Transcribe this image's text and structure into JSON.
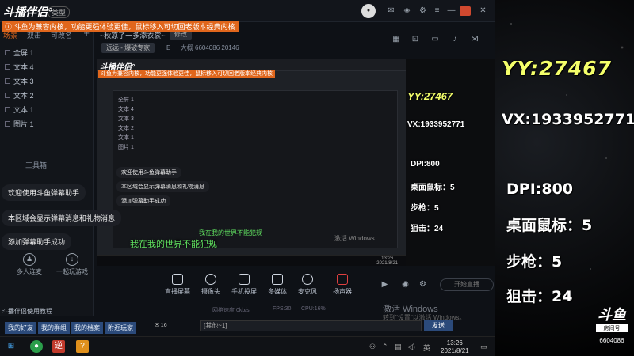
{
  "app": {
    "logo": "斗播伴侣°",
    "badge": "类型",
    "notice": "ⓘ 斗鱼为兼容内核，功能更强体验更佳，鼠标移入可切回老版本经典内核"
  },
  "left": {
    "tabs": [
      "场景",
      "双击",
      "可改名"
    ],
    "sources": [
      "全屏 1",
      "文本 4",
      "文本 3",
      "文本 2",
      "文本 1",
      "图片 1"
    ],
    "toolbar_label": "工具箱",
    "bubbles": [
      "欢迎使用斗鱼弹幕助手",
      "本区域会显示弹幕消息和礼物消息",
      "添加弹幕助手成功"
    ],
    "buttons": [
      "多人连麦",
      "一起玩游戏"
    ],
    "tutorial": "斗播伴侣使用教程"
  },
  "header": {
    "room_title": "~秋凉了一多添衣裳~",
    "edit_label": "修改",
    "category": "远远 - 爆破专家",
    "room_info": "E十. 大概  6604086    20146"
  },
  "preview": {
    "inner_logo": "斗播伴侣°",
    "inner_notice": "斗鱼为兼容内核，功能更强体验更佳，鼠标移入可切回老版本经典内核",
    "inner_overlay": {
      "yy": "YY:27467",
      "vx": "VX:1933952771",
      "dpi": "DPI:800",
      "desk": "桌面鼠标：5",
      "step": "步枪：5",
      "snipe": "狙击：24"
    },
    "nested_rows": [
      "全屏 1",
      "文本 4",
      "文本 3",
      "文本 2",
      "文本 1",
      "图片 1"
    ],
    "nested_bubbles": [
      "欢迎使用斗鱼弹幕助手",
      "本区域会显示弹幕消息和礼物消息",
      "添加弹幕助手成功"
    ],
    "green_message": "我在我的世界不能犯规",
    "green_message_small": "我在我的世界不能犯规",
    "activate": "激活 Windows",
    "inner_time": "13:26",
    "inner_date": "2021/8/21"
  },
  "controls": {
    "items": [
      "直播屏幕",
      "摄像头",
      "手机投屏",
      "多媒体",
      "麦克风",
      "扬声器"
    ],
    "start_live": "开始直播",
    "watermark": "激活 Windows",
    "watermark_sub": "转到\"设置\"以激活 Windows。"
  },
  "status": {
    "net": "网络速度 0kb/s",
    "fps": "FPS:30",
    "cpu": "CPU:16%"
  },
  "chat": {
    "tabs": [
      "我的好友",
      "我的群组",
      "我的档案",
      "附近玩家"
    ],
    "msg_count": "✉ 16",
    "input_value": "[其他~1]",
    "send_label": "发送"
  },
  "taskbar": {
    "time": "13:26",
    "date": "2021/8/21"
  },
  "overlay": {
    "yy": "YY:27467",
    "vx": "VX:1933952771",
    "dpi": "DPI:800",
    "desk": "桌面鼠标：5",
    "step": "步枪：5",
    "snipe": "狙击：24",
    "logo_mark": "斗鱼",
    "logo_sub": "房间号",
    "logo_num": "6604086"
  },
  "colors": {
    "overlay_text": "#f4ff6a",
    "accent": "#e0661c",
    "chat_green": "#60e060"
  }
}
